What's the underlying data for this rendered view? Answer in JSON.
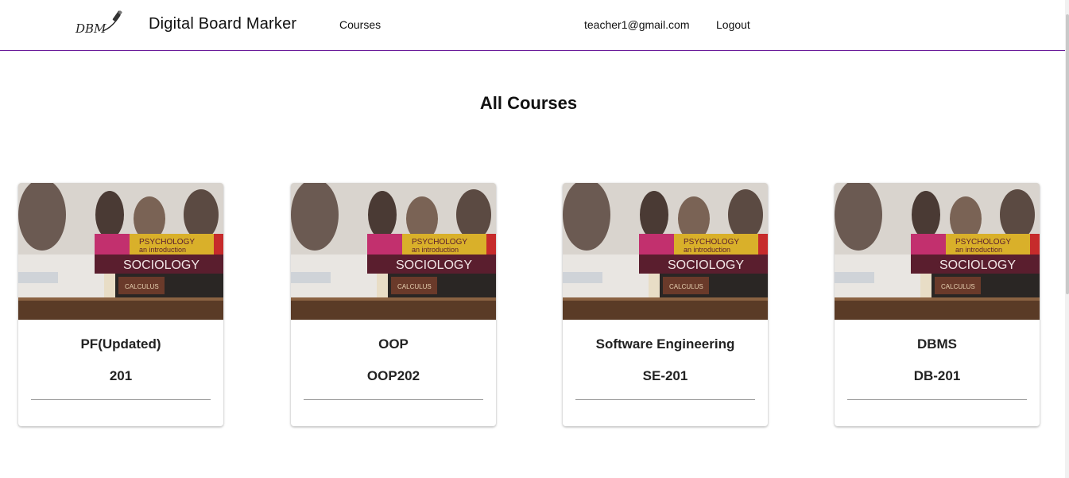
{
  "navbar": {
    "logo_text": "DBM",
    "brand": "Digital Board Marker",
    "courses_link": "Courses",
    "user_email": "teacher1@gmail.com",
    "logout": "Logout"
  },
  "page": {
    "title": "All Courses"
  },
  "courses": [
    {
      "name": "PF(Updated)",
      "code": "201",
      "book_labels": [
        "PSYCHOLOGY",
        "an introduction",
        "SOCIOLOGY",
        "CALCULUS"
      ]
    },
    {
      "name": "OOP",
      "code": "OOP202",
      "book_labels": [
        "PSYCHOLOGY",
        "an introduction",
        "SOCIOLOGY",
        "CALCULUS"
      ]
    },
    {
      "name": "Software Engineering",
      "code": "SE-201",
      "book_labels": [
        "PSYCHOLOGY",
        "an introduction",
        "SOCIOLOGY",
        "CALCULUS"
      ]
    },
    {
      "name": "DBMS",
      "code": "DB-201",
      "book_labels": [
        "PSYCHOLOGY",
        "an introduction",
        "SOCIOLOGY",
        "CALCULUS"
      ]
    }
  ],
  "colors": {
    "navbar_border": "#6a1b9a",
    "book_top": "#d9b02a",
    "book_top_accent": "#c2306e",
    "book_middle": "#5a1e2e",
    "book_bottom": "#2a2624"
  }
}
